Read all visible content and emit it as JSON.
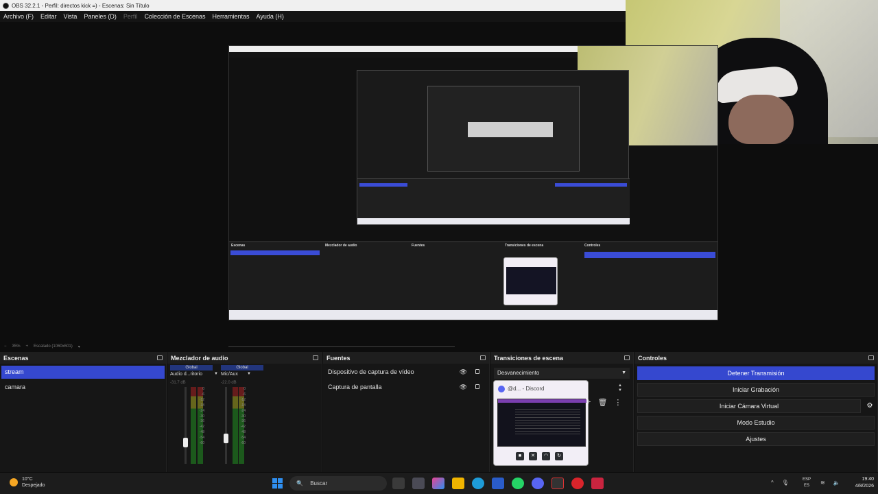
{
  "window": {
    "title": "OBS 32.2.1 - Perfil: directos kick =) - Escenas: Sin Título"
  },
  "menu": {
    "items": [
      "Archivo (F)",
      "Editar",
      "Vista",
      "Paneles (D)",
      "Perfil",
      "Colección de Escenas",
      "Herramientas",
      "Ayuda (H)"
    ]
  },
  "preview_bar": {
    "zoom": "35%",
    "scale": "Escalado (1060x601)"
  },
  "docks": {
    "scenes": {
      "title": "Escenas",
      "items": [
        {
          "label": "stream",
          "selected": true
        },
        {
          "label": "camara",
          "selected": false
        }
      ]
    },
    "mixer": {
      "title": "Mezclador de audio",
      "channels": [
        {
          "tag": "Global",
          "name": "Audio d...ritorio",
          "db": "-31.7 dB"
        },
        {
          "tag": "Global",
          "name": "Mic/Aux",
          "db": "-22.0 dB"
        }
      ],
      "scale": [
        "0",
        "-6",
        "-12",
        "-18",
        "-24",
        "-30",
        "-36",
        "-42",
        "-48",
        "-54",
        "-60"
      ]
    },
    "sources": {
      "title": "Fuentes",
      "items": [
        {
          "label": "Dispositivo de captura de vídeo"
        },
        {
          "label": "Captura de pantalla"
        }
      ]
    },
    "transitions": {
      "title": "Transiciones de escena",
      "selected": "Desvanecimiento"
    },
    "controls": {
      "title": "Controles",
      "buttons": [
        "Detener Transmisión",
        "Iniciar Grabación",
        "Iniciar Cámara Virtual",
        "Modo Estudio",
        "Ajustes"
      ]
    }
  },
  "discord_popup": {
    "title": "@d... - Discord"
  },
  "taskbar": {
    "weather_temp": "10°C",
    "weather_desc": "Despejado",
    "search_placeholder": "Buscar",
    "lang_top": "ESP",
    "lang_bottom": "ES",
    "time": "19:40",
    "date": "4/8/2026"
  },
  "colors": {
    "accent": "#3548cf",
    "dock_bg": "#161616"
  }
}
